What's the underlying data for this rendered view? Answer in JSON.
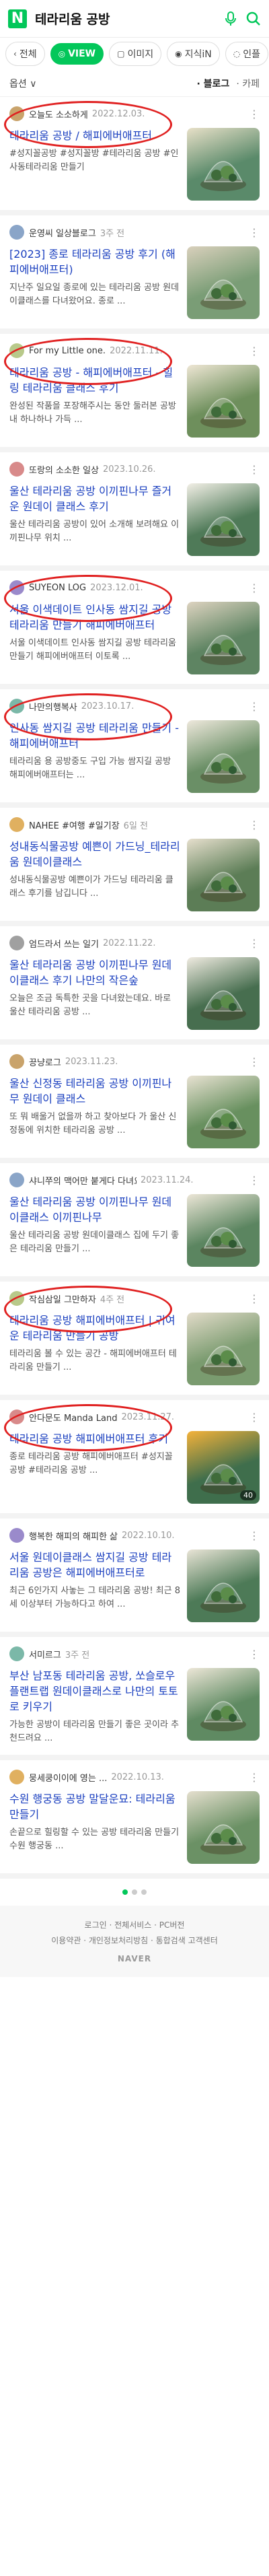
{
  "header": {
    "logo": "N",
    "query": "테라리움 공방"
  },
  "tabs": [
    {
      "label": "전체",
      "glyph": "‹"
    },
    {
      "label": "VIEW",
      "glyph": "◎",
      "active": true
    },
    {
      "label": "이미지",
      "glyph": "▢"
    },
    {
      "label": "지식iN",
      "glyph": "◉"
    },
    {
      "label": "인플",
      "glyph": "◌"
    }
  ],
  "filter": {
    "left": "옵션 ∨",
    "mid": "· 블로그",
    "right": "· 카페"
  },
  "cards": [
    {
      "author": "오늘도 소소하게",
      "date": "2022.12.03.",
      "title": "테라리움 공방 / 해피에버애프터",
      "desc": "#성지꼴공방 #성지꼴방 #테라리움 공방 #인사동테라리움 만들기",
      "thumb": "#5a8a6a",
      "accent": "#e8e0c8"
    },
    {
      "author": "운영씨 일상블로그",
      "date": "3주 전",
      "title": "[2023] 종로 테라리움 공방 후기 (해피에버애프터)",
      "desc": "지난주 일요일 종로에 있는 테라리움 공방 원데이클래스를 다녀왔어요. 종로 ...",
      "thumb": "#7a9d76",
      "accent": "#d9d0bc"
    },
    {
      "author": "For my Little one.",
      "date": "2022.11.11.",
      "title": "테라리움 공방 - 해피에버애프터 - 힐링 테라리움 클래스 후기",
      "desc": "완성된 작품을 포장해주시는 동안 둘러본 공방 내 하나하나 가득 ...",
      "thumb": "#6e8f5c",
      "accent": "#eee6d4"
    },
    {
      "author": "또랑의 소소한 일상",
      "date": "2023.10.26.",
      "title": "울산 테라리움 공방 이끼핀나무 즐거운 원데이 클래스 후기",
      "desc": "울산 테라리움 공방이 있어 소개해 보려해요 이끼핀나무 위치 ...",
      "thumb": "#4f7a58",
      "accent": "#f2efe6"
    },
    {
      "author": "SUYEON LOG",
      "date": "2023.12.01.",
      "title": "서울 이색데이트 인사동 쌈지길 공방 테라리움 만들기 해피에버애프터",
      "desc": "서울 이색데이트 인사동 쌈지길 공방 테라리움 만들기 해피에버애프터 이토록 ...",
      "thumb": "#5e8462",
      "accent": "#ddd3c0"
    },
    {
      "author": "나만의행복사",
      "date": "2023.10.17.",
      "title": "인사동 쌈지길 공방 테라리움 만들기 - 해피에버애프터",
      "desc": "테라리움 용 공방중도 구입 가능 쌈지길 공방 해피에버애프터는 ...",
      "thumb": "#6a8f66",
      "accent": "#eee8dc"
    },
    {
      "author": "NAHEE #여행 #일기장",
      "date": "6일 전",
      "title": "성내동식물공방 예쁜이 가드닝_테라리움 원데이클래스",
      "desc": "성내동식물공방 예쁜이가 가드닝 테라리움 클래스 후기를 남깁니다 ...",
      "thumb": "#5c7d56",
      "accent": "#e6dfcd"
    },
    {
      "author": "엄드라서 쓰는 일기",
      "date": "2022.11.22.",
      "title": "울산 테라리움 공방 이끼핀나무 원데이클래스 후기 나만의 작은숲",
      "desc": "오늘은 조금 독특한 곳을 다녀왔는데요. 바로 울산 테라리움 공방 ...",
      "thumb": "#476e4f",
      "accent": "#f0ebe1"
    },
    {
      "author": "끙냥로그",
      "date": "2023.11.23.",
      "title": "울산 신정동 테라리움 공방 이끼핀나무 원데이 클래스",
      "desc": "또 뭐 배울거 없을까 하고 찾아보다 가 울산 신정동에 위치한 테라리움 공방 ...",
      "thumb": "#68905f",
      "accent": "#e8e2d2"
    },
    {
      "author": "샤니쭈의 맥어만 붙게다 다녀요",
      "date": "2023.11.24.",
      "title": "울산 테라리움 공방 이끼핀나무 원데이클래스 이끼핀나무",
      "desc": "울산 테라리움 공방 원데이클래스 집에 두기 좋은 테라리움 만들기 ...",
      "thumb": "#5b8560",
      "accent": "#ece6d7"
    },
    {
      "author": "작심삼일 그만하자",
      "date": "4주 전",
      "title": "테라리움 공방 해피에버애프터 | 귀여운 테라리움 만들기 공방",
      "desc": "테라리움 볼 수 있는 공간 - 해피에버애프터 테라리움 만들기 ...",
      "thumb": "#7a9b6f",
      "accent": "#e2dbc9"
    },
    {
      "author": "안다문도 Manda Land",
      "date": "2023.11.27.",
      "title": "테라리움 공방 해피에버애프터 후기",
      "desc": "종로 테라리움 공방 해피에버애프터 #성지꼴공방 #테라리움 공방 ...",
      "thumb": "#3f6e4c",
      "accent": "#f4b23a",
      "count": "40"
    },
    {
      "author": "행복한 해피의 해피한 삶",
      "date": "2022.10.10.",
      "title": "서울 원데이클래스 쌈지길 공방 테라리움 공방은 해피에버애프터로",
      "desc": "최근 6인가지 사놓는 그 테라리움 공방! 최근 8세 이상부터 가능하다고 하여 ...",
      "thumb": "#4d7a57",
      "accent": "#e9e4d6"
    },
    {
      "author": "서미르그",
      "date": "3주 전",
      "title": "부산 남포동 테라리움 공방, 쏘슬로우플랜트랩 원데이클래스로 나만의 토토로 키우기",
      "desc": "가능한 공방이 테라리움 만들기 좋은 곳이라 추천드려요 ...",
      "thumb": "#5f8a62",
      "accent": "#ede7d8"
    },
    {
      "author": "뭉세쿵이이에 영는 ...",
      "date": "2022.10.13.",
      "title": "수원 행궁동 공방 말달운묘: 테라리움 만들기",
      "desc": "손끝으로 힐링할 수 있는 공방 테라리움 만들기 수원 행궁동 ...",
      "thumb": "#6b9165",
      "accent": "#e5dfce"
    }
  ],
  "footer": {
    "line1": "로그인 · 전체서비스 · PC버전",
    "line2": "이용약관 · 개인정보처리방침 · 통합검색 고객센터",
    "brand": "NAVER"
  }
}
